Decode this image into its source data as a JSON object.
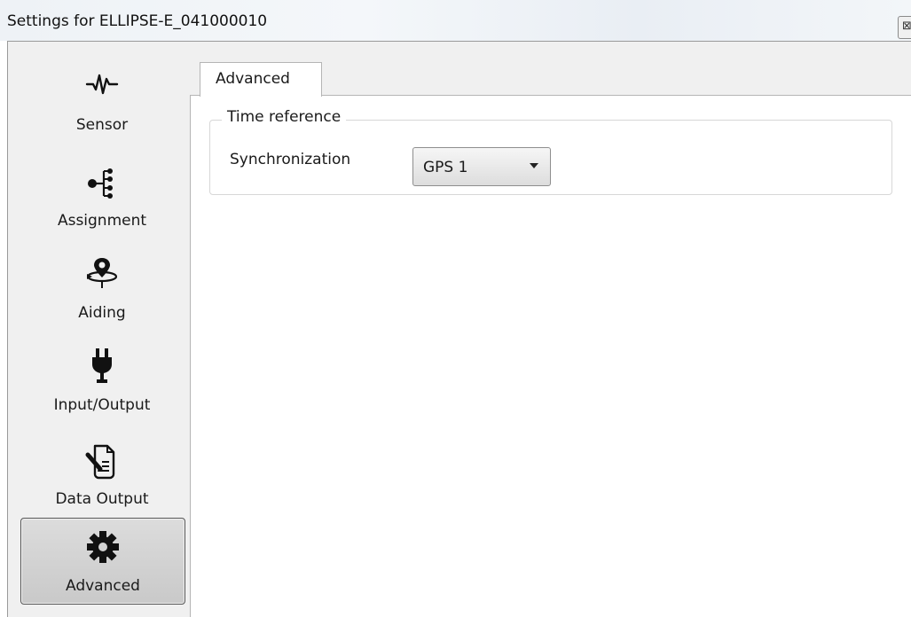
{
  "window": {
    "title": "Settings for ELLIPSE-E_041000010",
    "close_icon": "⊠"
  },
  "sidebar": {
    "items": [
      {
        "label": "Sensor",
        "icon": "waveform-icon",
        "active": false
      },
      {
        "label": "Assignment",
        "icon": "tree-icon",
        "active": false
      },
      {
        "label": "Aiding",
        "icon": "location-pin-orbit-icon",
        "active": false
      },
      {
        "label": "Input/Output",
        "icon": "plug-icon",
        "active": false
      },
      {
        "label": "Data Output",
        "icon": "document-pen-icon",
        "active": false
      },
      {
        "label": "Advanced",
        "icon": "gear-icon",
        "active": true
      }
    ]
  },
  "main": {
    "tabs": [
      {
        "label": "Advanced"
      }
    ],
    "group": {
      "legend": "Time reference",
      "field_label": "Synchronization",
      "dropdown_value": "GPS 1"
    }
  }
}
